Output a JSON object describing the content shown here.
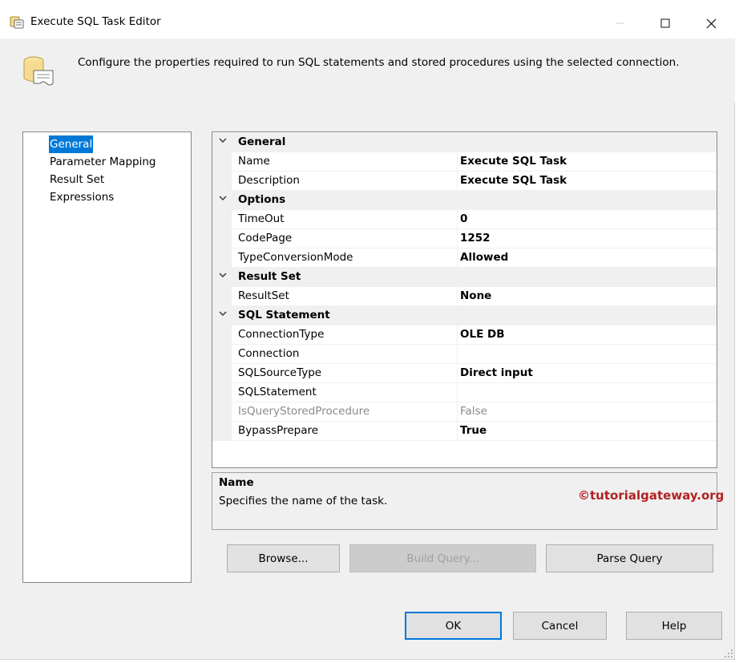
{
  "window": {
    "title": "Execute SQL Task Editor",
    "icons": {
      "title": "task-editor-icon",
      "minimize": "minimize-icon",
      "maximize": "maximize-icon",
      "close": "close-icon"
    }
  },
  "header": {
    "description": "Configure the properties required to run SQL statements and stored procedures using the selected connection.",
    "icon": "database-scroll-icon"
  },
  "nav": {
    "items": [
      {
        "label": "General",
        "selected": true
      },
      {
        "label": "Parameter Mapping"
      },
      {
        "label": "Result Set"
      },
      {
        "label": "Expressions"
      }
    ]
  },
  "properties": {
    "general": {
      "label": "General",
      "name": {
        "label": "Name",
        "value": "Execute SQL Task"
      },
      "description": {
        "label": "Description",
        "value": "Execute SQL Task"
      }
    },
    "options": {
      "label": "Options",
      "timeout": {
        "label": "TimeOut",
        "value": "0"
      },
      "codepage": {
        "label": "CodePage",
        "value": "1252"
      },
      "typeconversion": {
        "label": "TypeConversionMode",
        "value": "Allowed"
      }
    },
    "resultset": {
      "label": "Result Set",
      "resultset": {
        "label": "ResultSet",
        "value": "None"
      }
    },
    "sql": {
      "label": "SQL Statement",
      "connectiontype": {
        "label": "ConnectionType",
        "value": "OLE DB"
      },
      "connection": {
        "label": "Connection",
        "value": ""
      },
      "sqlsourcetype": {
        "label": "SQLSourceType",
        "value": "Direct input"
      },
      "sqlstatement": {
        "label": "SQLStatement",
        "value": ""
      },
      "isquerystoredprocedure": {
        "label": "IsQueryStoredProcedure",
        "value": "False"
      },
      "bypassprepare": {
        "label": "BypassPrepare",
        "value": "True"
      }
    }
  },
  "description_panel": {
    "title": "Name",
    "text": "Specifies the name of the task.",
    "watermark": "©tutorialgateway.org"
  },
  "buttons": {
    "browse": "Browse...",
    "build_query": "Build Query...",
    "parse_query": "Parse Query",
    "ok": "OK",
    "cancel": "Cancel",
    "help": "Help"
  },
  "colors": {
    "selection": "#0078d7",
    "panel": "#f0f0f0",
    "watermark": "#b22222"
  }
}
